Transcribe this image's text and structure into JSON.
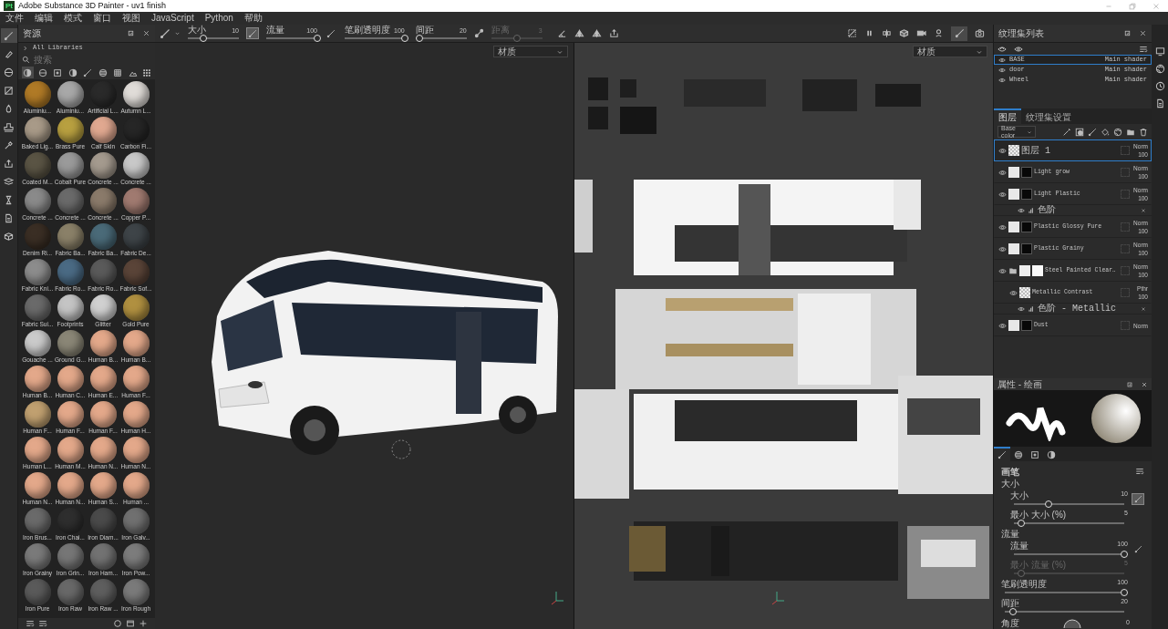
{
  "window": {
    "title": "Adobe Substance 3D Painter - uv1 finish",
    "app_logo": "Pt"
  },
  "menu": [
    "文件",
    "编辑",
    "模式",
    "窗口",
    "视图",
    "JavaScript",
    "Python",
    "帮助"
  ],
  "tool_options": [
    {
      "label": "大小",
      "value": "10",
      "level": 0.3,
      "disabled": false,
      "pressure_active": true
    },
    {
      "label": "流量",
      "value": "100",
      "level": 1,
      "disabled": false,
      "pressure_active": false
    },
    {
      "label": "笔刷透明度",
      "value": "100",
      "level": 1,
      "disabled": false
    },
    {
      "label": "间距",
      "value": "20",
      "level": 0.08,
      "disabled": false
    },
    {
      "label": "距离",
      "value": "3",
      "level": 0.5,
      "disabled": true
    }
  ],
  "left_tools": [
    {
      "selected": true
    },
    {
      "selected": false
    },
    {
      "selected": false
    },
    {
      "selected": false
    },
    {
      "selected": false
    },
    {
      "selected": false
    },
    {
      "selected": false
    },
    {
      "selected": false
    },
    {
      "selected": false
    },
    {
      "selected": false
    },
    {
      "selected": false
    },
    {
      "selected": false
    }
  ],
  "assets": {
    "title": "资源",
    "breadcrumb": "All Libraries",
    "search": {
      "placeholder": "搜索"
    },
    "filters": [
      {
        "selected": true
      },
      {
        "selected": false
      },
      {
        "selected": false
      },
      {
        "selected": false
      },
      {
        "selected": false
      },
      {
        "selected": false
      },
      {
        "selected": false
      },
      {
        "selected": false
      }
    ],
    "materials": [
      {
        "name": "Aluminiu...",
        "color": "#b07a26"
      },
      {
        "name": "Aluminiu...",
        "color": "#a8a8a8"
      },
      {
        "name": "Artificial L...",
        "color": "#2a2a2a"
      },
      {
        "name": "Autumn L...",
        "color": "#e0dcd8"
      },
      {
        "name": "Baked Lig...",
        "color": "#a89a88"
      },
      {
        "name": "Brass Pure",
        "color": "#b8a040"
      },
      {
        "name": "Calf Skin",
        "color": "#e0a890"
      },
      {
        "name": "Carbon Fi...",
        "color": "#262626"
      },
      {
        "name": "Coated M...",
        "color": "#5a5444"
      },
      {
        "name": "Cobalt Pure",
        "color": "#9a9a9a"
      },
      {
        "name": "Concrete ...",
        "color": "#a49a8e"
      },
      {
        "name": "Concrete ...",
        "color": "#c8c8c8"
      },
      {
        "name": "Concrete ...",
        "color": "#8a8a8a"
      },
      {
        "name": "Concrete ...",
        "color": "#6a6a6a"
      },
      {
        "name": "Concrete ...",
        "color": "#8a7a6a"
      },
      {
        "name": "Copper P...",
        "color": "#a07a70"
      },
      {
        "name": "Denim Ri...",
        "color": "#3a2e24"
      },
      {
        "name": "Fabric Ba...",
        "color": "#8a8068"
      },
      {
        "name": "Fabric Ba...",
        "color": "#4a6a78"
      },
      {
        "name": "Fabric De...",
        "color": "#3e4448"
      },
      {
        "name": "Fabric Kni...",
        "color": "#8c8c8c"
      },
      {
        "name": "Fabric Ro...",
        "color": "#4a6a84"
      },
      {
        "name": "Fabric Ro...",
        "color": "#5a5a5a"
      },
      {
        "name": "Fabric Sof...",
        "color": "#5a4438"
      },
      {
        "name": "Fabric Sui...",
        "color": "#6a6a6a"
      },
      {
        "name": "Footprints",
        "color": "#c4c4c4"
      },
      {
        "name": "Glitter",
        "color": "#d0d0d0"
      },
      {
        "name": "Gold Pure",
        "color": "#b09040"
      },
      {
        "name": "Gouache ...",
        "color": "#cacaca"
      },
      {
        "name": "Ground G...",
        "color": "#8a8676"
      },
      {
        "name": "Human B...",
        "color": "#e3a88a"
      },
      {
        "name": "Human B...",
        "color": "#e3a88a"
      },
      {
        "name": "Human B...",
        "color": "#e3a88a"
      },
      {
        "name": "Human C...",
        "color": "#e3a88a"
      },
      {
        "name": "Human E...",
        "color": "#e3a88a"
      },
      {
        "name": "Human F...",
        "color": "#e3a88a"
      },
      {
        "name": "Human F...",
        "color": "#c0a070"
      },
      {
        "name": "Human F...",
        "color": "#e3a88a"
      },
      {
        "name": "Human F...",
        "color": "#e3a88a"
      },
      {
        "name": "Human H...",
        "color": "#e3a88a"
      },
      {
        "name": "Human L...",
        "color": "#e3a88a"
      },
      {
        "name": "Human M...",
        "color": "#e3a88a"
      },
      {
        "name": "Human N...",
        "color": "#e3a88a"
      },
      {
        "name": "Human N...",
        "color": "#e3a88a"
      },
      {
        "name": "Human N...",
        "color": "#e3a88a"
      },
      {
        "name": "Human N...",
        "color": "#e3a88a"
      },
      {
        "name": "Human S...",
        "color": "#e3a88a"
      },
      {
        "name": "Human ...",
        "color": "#e3a88a"
      },
      {
        "name": "Iron Brus...",
        "color": "#6a6a6a"
      },
      {
        "name": "Iron Chai...",
        "color": "#2e2e2e"
      },
      {
        "name": "Iron Diam...",
        "color": "#4a4a4a"
      },
      {
        "name": "Iron Galv...",
        "color": "#707070"
      },
      {
        "name": "Iron Grainy",
        "color": "#7a7a7a"
      },
      {
        "name": "Iron Grin...",
        "color": "#767676"
      },
      {
        "name": "Iron Ham...",
        "color": "#727272"
      },
      {
        "name": "Iron Pow...",
        "color": "#7c7c7c"
      },
      {
        "name": "Iron Pure",
        "color": "#5a5a5a"
      },
      {
        "name": "Iron Raw",
        "color": "#686868"
      },
      {
        "name": "Iron Raw ...",
        "color": "#5e5e5e"
      },
      {
        "name": "Iron Rough",
        "color": "#7a7a7a"
      }
    ]
  },
  "viewports": [
    {
      "kind": "model",
      "dropdown": "材质"
    },
    {
      "kind": "uv",
      "dropdown": "材质"
    }
  ],
  "texture_sets": {
    "title": "纹理集列表",
    "items": [
      {
        "name": "BASE",
        "shader": "Main shader",
        "selected": true
      },
      {
        "name": "door",
        "shader": "Main shader",
        "selected": false
      },
      {
        "name": "Wheel",
        "shader": "Main shader",
        "selected": false
      }
    ]
  },
  "layers_panel": {
    "tabs": [
      {
        "label": "图层",
        "selected": true
      },
      {
        "label": "纹理集设置",
        "selected": false
      }
    ],
    "channel": "Base color",
    "layers": [
      {
        "kind": "paint",
        "name": "图层 1",
        "blend": "Norm",
        "opacity": "100",
        "selected": true
      },
      {
        "kind": "fill",
        "name": "Light grow",
        "blend": "Norm",
        "opacity": "100",
        "selected": false
      },
      {
        "kind": "fill",
        "name": "Light Plastic",
        "blend": "Norm",
        "opacity": "100",
        "selected": false,
        "effects": [
          {
            "name": "色阶"
          }
        ]
      },
      {
        "kind": "fill",
        "name": "Plastic Glossy Pure",
        "blend": "Norm",
        "opacity": "100",
        "selected": false
      },
      {
        "kind": "fill",
        "name": "Plastic Grainy",
        "blend": "Norm",
        "opacity": "100",
        "selected": false
      },
      {
        "kind": "folder",
        "name": "Steel Painted Clear‥",
        "blend": "Norm",
        "opacity": "100",
        "selected": false,
        "children": [
          {
            "kind": "paint",
            "name": "Metallic Contrast",
            "blend": "Pthr",
            "opacity": "100",
            "selected": false,
            "effects": [
              {
                "name": "色阶 - Metallic"
              }
            ]
          }
        ]
      },
      {
        "kind": "fill",
        "name": "Dust",
        "blend": "Norm",
        "selected": false
      }
    ]
  },
  "properties": {
    "title": "属性 - 绘画",
    "tabs": [
      {
        "selected": true
      },
      {
        "selected": false
      },
      {
        "selected": false
      },
      {
        "selected": false
      }
    ],
    "section": "画笔",
    "settings": [
      {
        "kind": "heading",
        "label": "大小"
      },
      {
        "kind": "subslider",
        "label": "大小",
        "value": "10",
        "level": 0.31,
        "disabled": false,
        "pressure_active": true
      },
      {
        "kind": "subslider",
        "label": "最小 大小 (%)",
        "value": "5",
        "level": 0.07,
        "disabled": false
      },
      {
        "kind": "heading",
        "label": "流量"
      },
      {
        "kind": "subslider",
        "label": "流量",
        "value": "100",
        "level": 1,
        "disabled": false,
        "pressure_active": false
      },
      {
        "kind": "subslider",
        "label": "最小 流量 (%)",
        "value": "5",
        "level": 0.07,
        "disabled": true
      },
      {
        "kind": "slider",
        "label": "笔刷透明度",
        "value": "100",
        "level": 1,
        "disabled": false
      },
      {
        "kind": "slider",
        "label": "间距",
        "value": "20",
        "level": 0.07,
        "disabled": false
      },
      {
        "kind": "dial",
        "label": "角度",
        "value": "0"
      }
    ]
  }
}
